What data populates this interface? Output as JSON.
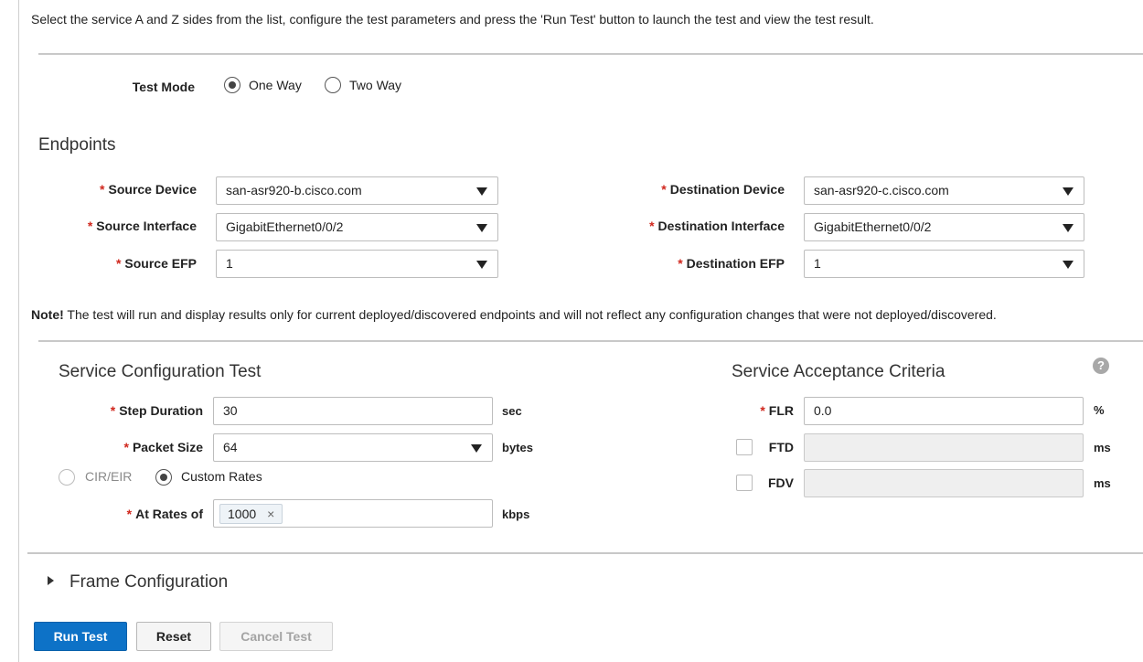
{
  "intro_text": "Select the service A and Z sides from the list, configure the test parameters and press the 'Run Test' button to launch the test and view the test result.",
  "test_mode": {
    "label": "Test Mode",
    "options": [
      "One Way",
      "Two Way"
    ],
    "selected": "One Way"
  },
  "endpoints": {
    "title": "Endpoints",
    "required_mark": "*",
    "source_device": {
      "label": "Source Device",
      "value": "san-asr920-b.cisco.com"
    },
    "source_interface": {
      "label": "Source Interface",
      "value": "GigabitEthernet0/0/2"
    },
    "source_efp": {
      "label": "Source EFP",
      "value": "1"
    },
    "destination_device": {
      "label": "Destination Device",
      "value": "san-asr920-c.cisco.com"
    },
    "destination_interface": {
      "label": "Destination Interface",
      "value": "GigabitEthernet0/0/2"
    },
    "destination_efp": {
      "label": "Destination EFP",
      "value": "1"
    }
  },
  "note": {
    "prefix": "Note!",
    "text": " The test will run and display results only for current deployed/discovered endpoints and will not reflect any configuration changes that were not deployed/discovered."
  },
  "service_config": {
    "title": "Service Configuration Test",
    "step_duration": {
      "label": "Step Duration",
      "value": "30",
      "unit": "sec"
    },
    "packet_size": {
      "label": "Packet Size",
      "value": "64",
      "unit": "bytes"
    },
    "rate_mode": {
      "options": [
        "CIR/EIR",
        "Custom Rates"
      ],
      "selected": "Custom Rates"
    },
    "at_rates": {
      "label": "At Rates of",
      "tag": "1000",
      "tag_remove": "×",
      "unit": "kbps"
    }
  },
  "acceptance": {
    "title": "Service Acceptance Criteria",
    "help_icon": "?",
    "flr": {
      "label": "FLR",
      "value": "0.0",
      "unit": "%"
    },
    "ftd": {
      "label": "FTD",
      "value": "",
      "unit": "ms",
      "checked": false
    },
    "fdv": {
      "label": "FDV",
      "value": "",
      "unit": "ms",
      "checked": false
    }
  },
  "frame_config": {
    "label": "Frame Configuration",
    "expanded": false
  },
  "buttons": {
    "run": "Run Test",
    "reset": "Reset",
    "cancel": "Cancel Test"
  },
  "colors": {
    "primary": "#0d72c7",
    "required": "#d0271d",
    "divider": "#c8c8c8"
  }
}
